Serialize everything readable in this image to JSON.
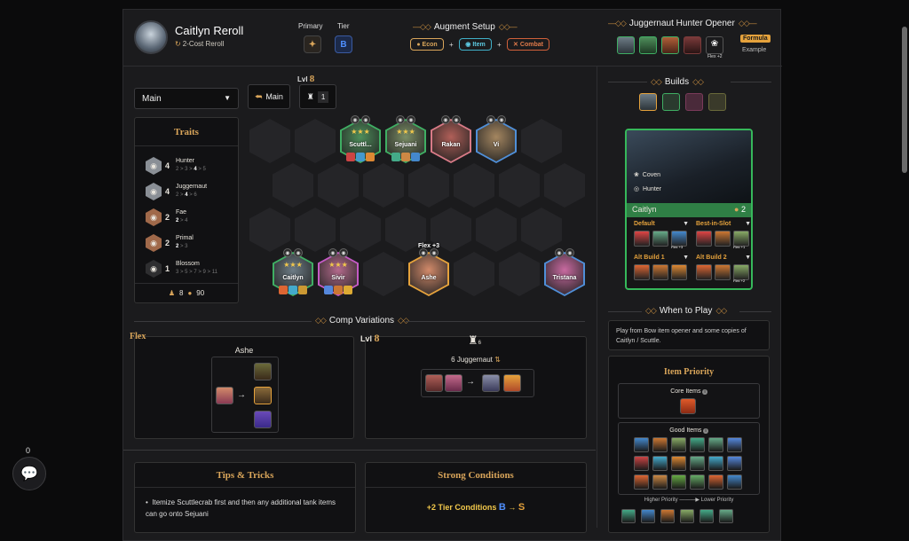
{
  "header": {
    "title": "Caitlyn Reroll",
    "subtitle": "2-Cost Reroll",
    "primary_label": "Primary",
    "tier_label": "Tier",
    "tier_value": "B",
    "augment_title": "Augment Setup",
    "augments": [
      "Econ",
      "Item",
      "Combat"
    ],
    "plus": "+",
    "opener_title": "Juggernaut Hunter Opener",
    "opener_flex": "Flex +2",
    "formula_badge": "Formula",
    "example_label": "Example"
  },
  "toolbar": {
    "select_value": "Main",
    "main_button": "Main",
    "level_label": "Lvl",
    "level_value": "8",
    "count_value": "1"
  },
  "traits": {
    "title": "Traits",
    "items": [
      {
        "count": "4",
        "name": "Hunter",
        "b1": "2 > 3 >",
        "cur": "4",
        "b2": "> 5",
        "color": "#8a8f96"
      },
      {
        "count": "4",
        "name": "Juggernaut",
        "b1": "2 >",
        "cur": "4",
        "b2": "> 6",
        "color": "#8a8f96"
      },
      {
        "count": "2",
        "name": "Fae",
        "b1": "",
        "cur": "2",
        "b2": "> 4",
        "color": "#a0694a"
      },
      {
        "count": "2",
        "name": "Primal",
        "b1": "",
        "cur": "2",
        "b2": "> 3",
        "color": "#a0694a"
      },
      {
        "count": "1",
        "name": "Blossom",
        "b1": "3 > 5 > 7 > 9 > 11",
        "cur": "",
        "b2": "",
        "color": "#2e2e30"
      }
    ],
    "footer_units": "8",
    "footer_gold": "90"
  },
  "board": {
    "units": [
      {
        "name": "Scuttl...",
        "stars": "★★★",
        "color": "#4e8e5b",
        "border": "#3fae63"
      },
      {
        "name": "Sejuani",
        "stars": "★★★",
        "color": "#7a8d66",
        "border": "#3fae63"
      },
      {
        "name": "Rakan",
        "stars": "",
        "color": "#b05f58",
        "border": "#d87a86"
      },
      {
        "name": "Vi",
        "stars": "",
        "color": "#a48660",
        "border": "#4f8fd8"
      },
      {
        "name": "Caitlyn",
        "stars": "★★★",
        "color": "#6d7c86",
        "border": "#3fae63"
      },
      {
        "name": "Sivir",
        "stars": "★★★",
        "color": "#b46a8c",
        "border": "#c45ac4"
      },
      {
        "name": "Ashe",
        "stars": "",
        "color": "#d28a6a",
        "border": "#e5a23c",
        "flex": "Flex +3"
      },
      {
        "name": "Tristana",
        "stars": "",
        "color": "#c86aa0",
        "border": "#4f8fd8"
      }
    ]
  },
  "variations": {
    "title": "Comp Variations",
    "flex_label": "Flex",
    "flex_unit": "Ashe",
    "level_label": "Lvl",
    "level_value": "8",
    "jugg_count": "6",
    "jugg_label": "6 Juggernaut"
  },
  "tips": {
    "title": "Tips & Tricks",
    "text": "Itemize Scuttlecrab first and then any additional tank items can go onto Sejuani"
  },
  "conditions": {
    "title": "Strong Conditions",
    "tier_text": "+2 Tier Conditions",
    "from": "B",
    "to": "S"
  },
  "builds": {
    "title": "Builds",
    "champion": "Caitlyn",
    "cost": "2",
    "traits": [
      "Coven",
      "Hunter"
    ],
    "slots": [
      {
        "label": "Default",
        "flex": "Flex +3"
      },
      {
        "label": "Best-in-Slot",
        "flex": "Flex +1"
      },
      {
        "label": "Alt Build 1",
        "flex": ""
      },
      {
        "label": "Alt Build 2",
        "flex": "Flex +2"
      }
    ]
  },
  "when": {
    "title": "When to Play",
    "text": "Play from Bow item opener and some copies of Caitlyn / Scuttle."
  },
  "priority": {
    "title": "Item Priority",
    "core": "Core Items",
    "good": "Good Items",
    "higher": "Higher Priority",
    "lower": "Lower Priority"
  },
  "chat": {
    "count": "0"
  }
}
